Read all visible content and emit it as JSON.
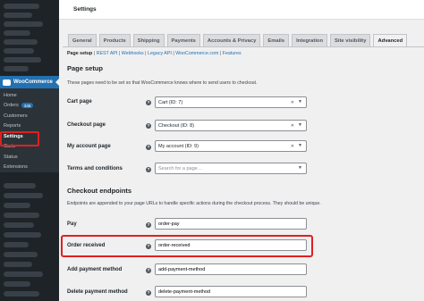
{
  "header": {
    "title": "Settings"
  },
  "sidebar": {
    "woocommerce_label": "WooCommerce",
    "items": [
      {
        "label": "Home"
      },
      {
        "label": "Orders",
        "badge": "345"
      },
      {
        "label": "Customers"
      },
      {
        "label": "Reports"
      },
      {
        "label": "Settings"
      },
      {
        "label": "Carts"
      },
      {
        "label": "Status"
      },
      {
        "label": "Extensions"
      }
    ]
  },
  "tabs": [
    {
      "label": "General"
    },
    {
      "label": "Products"
    },
    {
      "label": "Shipping"
    },
    {
      "label": "Payments"
    },
    {
      "label": "Accounts & Privacy"
    },
    {
      "label": "Emails"
    },
    {
      "label": "Integration"
    },
    {
      "label": "Site visibility"
    },
    {
      "label": "Advanced",
      "active": true
    }
  ],
  "subsub": {
    "current": "Page setup",
    "links": [
      "REST API",
      "Webhooks",
      "Legacy API",
      "WooCommerce.com",
      "Features"
    ],
    "separator": "|"
  },
  "page_setup": {
    "heading": "Page setup",
    "description": "These pages need to be set so that WooCommerce knows where to send users to checkout.",
    "rows": [
      {
        "label": "Cart page",
        "value": "Cart (ID: 7)"
      },
      {
        "label": "Checkout page",
        "value": "Checkout (ID: 8)"
      },
      {
        "label": "My account page",
        "value": "My account (ID: 9)"
      },
      {
        "label": "Terms and conditions",
        "placeholder": "Search for a page…"
      }
    ]
  },
  "endpoints": {
    "heading": "Checkout endpoints",
    "description": "Endpoints are appended to your page URLs to handle specific actions during the checkout process. They should be unique.",
    "rows": [
      {
        "label": "Pay",
        "value": "order-pay"
      },
      {
        "label": "Order received",
        "value": "order-received"
      },
      {
        "label": "Add payment method",
        "value": "add-payment-method"
      },
      {
        "label": "Delete payment method",
        "value": "delete-payment-method"
      }
    ]
  },
  "icons": {
    "help": "help-icon",
    "clear": "clear-icon",
    "dropdown": "chevron-down-icon",
    "logo": "woocommerce-logo-icon"
  },
  "colors": {
    "accent": "#2271b1",
    "highlight": "#e02020",
    "sidebar": "#1d2327"
  }
}
